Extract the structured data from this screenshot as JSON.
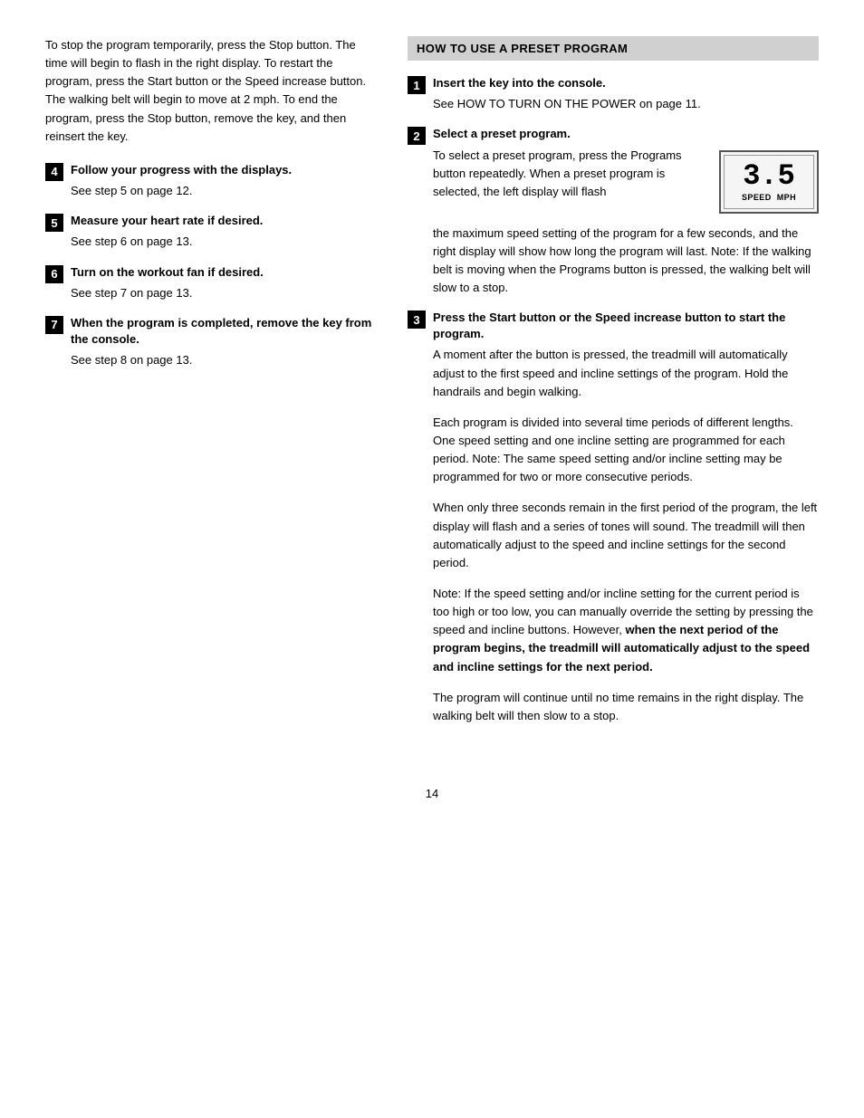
{
  "left": {
    "intro": "To stop the program temporarily, press the Stop button. The time will begin to flash in the right display. To restart the program, press the Start button or the Speed increase button. The walking belt will begin to move at 2 mph. To end the program, press the Stop button, remove the key, and then reinsert the key.",
    "steps": [
      {
        "num": "4",
        "title": "Follow your progress with the displays.",
        "body": "See step 5 on page 12."
      },
      {
        "num": "5",
        "title": "Measure your heart rate if desired.",
        "body": "See step 6 on page 13."
      },
      {
        "num": "6",
        "title": "Turn on the workout fan if desired.",
        "body": "See step 7 on page 13."
      },
      {
        "num": "7",
        "title": "When the program is completed, remove the key from the console.",
        "body": "See step 8 on page 13."
      }
    ]
  },
  "right": {
    "section_header": "HOW TO USE A PRESET PROGRAM",
    "steps": [
      {
        "num": "1",
        "title": "Insert the key into the console.",
        "body": "See HOW TO TURN ON THE POWER on page 11.",
        "has_display": false,
        "display_number": ""
      },
      {
        "num": "2",
        "title": "Select a preset program.",
        "body_before": "To select a preset program, press the Programs button repeatedly. When a preset program is selected, the left display will flash",
        "body_after": "the maximum speed setting of the program for a few seconds, and the right display will show how long the program will last. Note: If the walking belt is moving when the Programs button is pressed, the walking belt will slow to a stop.",
        "has_display": true,
        "display_number": "3.5",
        "display_label_left": "SPEED",
        "display_label_right": "MPH"
      },
      {
        "num": "3",
        "title": "Press the Start button or the Speed increase button to start the program.",
        "paragraphs": [
          "A moment after the button is pressed, the treadmill will automatically adjust to the first speed and incline settings of the program. Hold the handrails and begin walking.",
          "Each program is divided into several time periods of different lengths. One speed setting and one incline setting are programmed for each period. Note: The same speed setting and/or incline setting may be programmed for two or more consecutive periods.",
          "When only three seconds remain in the first period of the program, the left display will flash and a series of tones will sound. The treadmill will then automatically adjust to the speed and incline settings for the second period.",
          "Note: If the speed setting and/or incline setting for the current period is too high or too low, you can manually override the setting by pressing the speed and incline buttons. However, [BOLD]when the next period of the program begins, the treadmill will automatically adjust to the speed and incline settings for the next period.[/BOLD]",
          "The program will continue until no time remains in the right display. The walking belt will then slow to a stop."
        ]
      }
    ]
  },
  "page_number": "14"
}
